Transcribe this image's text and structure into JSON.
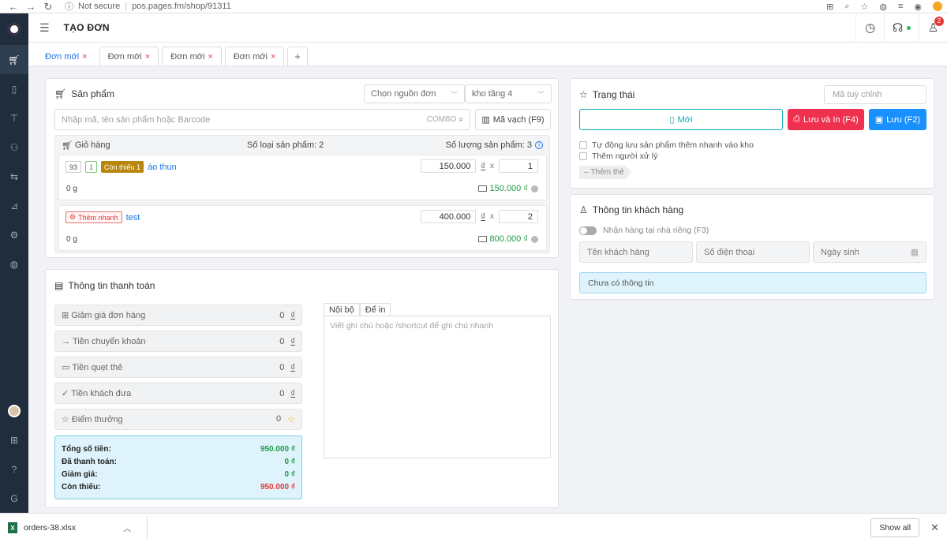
{
  "browser": {
    "security": "Not secure",
    "url": "pos.pages.fm/shop/91311"
  },
  "header": {
    "title": "TẠO ĐƠN",
    "notification_count": "2"
  },
  "tabs": [
    {
      "label": "Đơn mới",
      "active": true
    },
    {
      "label": "Đơn mới"
    },
    {
      "label": "Đơn mới"
    },
    {
      "label": "Đơn mới"
    }
  ],
  "product": {
    "title": "Sản phẩm",
    "source_select": "Chọn nguồn đơn",
    "warehouse_select": "kho tầng 4",
    "search_placeholder": "Nhập mã, tên sản phẩm hoặc Barcode",
    "combo_label": "COMBO",
    "barcode_button": "Mã vạch (F9)",
    "cart": {
      "title": "Giỏ hàng",
      "product_types": "Số loại sản phẩm: 2",
      "product_quantity": "Số lượng sản phẩm: 3",
      "items": [
        {
          "code": "93",
          "qty_badge": "1",
          "status_badge": "Còn thiếu 1",
          "name": "áo thun",
          "price": "150.000",
          "currency": "₫",
          "times": "x",
          "quantity": "1",
          "weight": "0 g",
          "total": "150.000 ₫"
        },
        {
          "quick_tag": "Thêm nhanh",
          "name": "test",
          "price": "400.000",
          "currency": "₫",
          "times": "x",
          "quantity": "2",
          "weight": "0 g",
          "total": "800.000 ₫"
        }
      ]
    }
  },
  "payment": {
    "title": "Thông tin thanh toán",
    "rows": [
      {
        "label": "Giảm giá đơn hàng",
        "value": "0",
        "unit": "₫"
      },
      {
        "label": "Tiền chuyển khoản",
        "value": "0",
        "unit": "₫"
      },
      {
        "label": "Tiền quẹt thẻ",
        "value": "0",
        "unit": "₫"
      },
      {
        "label": "Tiền khách đưa",
        "value": "0",
        "unit": "₫"
      },
      {
        "label": "Điểm thưởng",
        "value": "0",
        "unit": "☆"
      }
    ],
    "summary": {
      "total_label": "Tổng số tiền:",
      "total_value": "950.000 ₫",
      "paid_label": "Đã thanh toán:",
      "paid_value": "0 ₫",
      "discount_label": "Giảm giá:",
      "discount_value": "0 ₫",
      "remaining_label": "Còn thiếu:",
      "remaining_value": "950.000 ₫"
    },
    "note_tabs": [
      "Nội bộ",
      "Để in"
    ],
    "note_placeholder": "Viết ghi chú hoặc /shortcut để ghi chú nhanh"
  },
  "status": {
    "title": "Trạng thái",
    "custom_code_placeholder": "Mã tuỳ chỉnh",
    "new_button": "Mới",
    "save_print_button": "Lưu và In (F4)",
    "save_button": "Lưu (F2)",
    "checkbox_auto_save": "Tự động lưu sản phẩm thêm nhanh vào kho",
    "checkbox_add_handler": "Thêm người xử lý",
    "add_tag": "Thêm thẻ"
  },
  "customer": {
    "title": "Thông tin khách hàng",
    "home_delivery_toggle": "Nhận hàng tại nhà riêng (F3)",
    "name_placeholder": "Tên khách hàng",
    "phone_placeholder": "Số điện thoại",
    "birthday_placeholder": "Ngày sinh",
    "info_message": "Chưa có thông tin"
  },
  "download_bar": {
    "file_name": "orders-38.xlsx",
    "show_all": "Show all"
  },
  "colors": {
    "sidebar_bg": "#1f2d3d",
    "primary_blue": "#1a73e8",
    "save_print_red": "#f0304f",
    "save_blue": "#1890ff",
    "new_button_border": "#13a8b6",
    "success_green": "#1e9b46",
    "danger_red": "#e53935"
  }
}
